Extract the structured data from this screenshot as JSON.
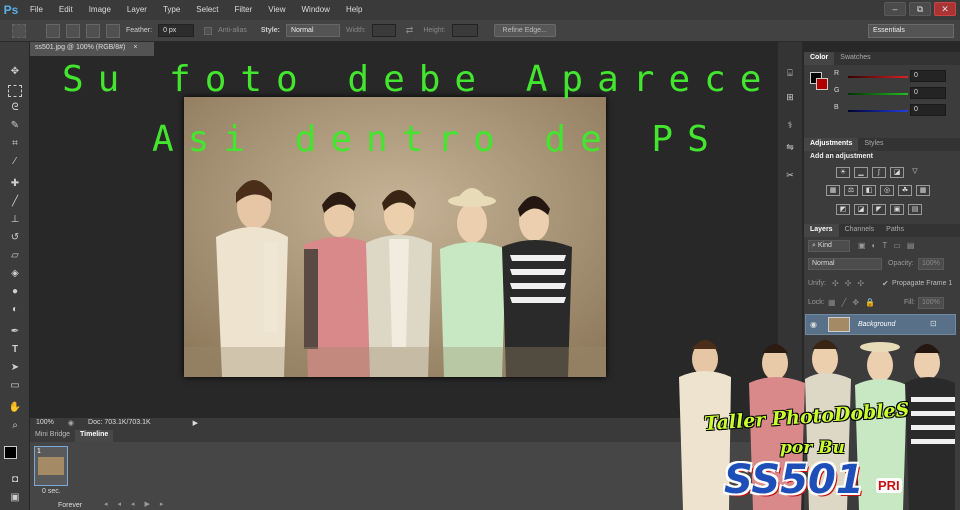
{
  "app": {
    "logo": "Ps"
  },
  "menu": [
    "File",
    "Edit",
    "Image",
    "Layer",
    "Type",
    "Select",
    "Filter",
    "View",
    "Window",
    "Help"
  ],
  "window_controls": [
    "–",
    "⧉",
    "✕"
  ],
  "options_bar": {
    "feather_label": "Feather:",
    "feather_value": "0 px",
    "antialias_label": "Anti-alias",
    "style_label": "Style:",
    "style_value": "Normal",
    "width_label": "Width:",
    "height_label": "Height:",
    "refine_edge": "Refine Edge...",
    "workspace": "Essentials"
  },
  "document": {
    "tab_title": "ss501.jpg @ 100% (RGB/8#)",
    "close": "×",
    "caption_line1": "Su foto  debe Aparecer",
    "caption_line2": "Asi dentro de PS"
  },
  "status_bar": {
    "zoom": "100%",
    "doc": "Doc: 703.1K/703.1K"
  },
  "bottom_tabs": [
    "Mini Bridge",
    "Timeline"
  ],
  "timeline": {
    "frame_number": "1",
    "frame_delay": "0 sec.",
    "loop": "Forever"
  },
  "color_panel": {
    "tabs": [
      "Color",
      "Swatches"
    ],
    "channels": [
      {
        "label": "R",
        "value": "0",
        "color": "#e02020"
      },
      {
        "label": "G",
        "value": "0",
        "color": "#20c020"
      },
      {
        "label": "B",
        "value": "0",
        "color": "#2040e0"
      }
    ]
  },
  "adjustments_panel": {
    "tabs": [
      "Adjustments",
      "Styles"
    ],
    "heading": "Add an adjustment"
  },
  "layers_panel": {
    "tabs": [
      "Layers",
      "Channels",
      "Paths"
    ],
    "kind": "Kind",
    "blend_mode": "Normal",
    "opacity_label": "Opacity:",
    "opacity_value": "100%",
    "unify_label": "Unify:",
    "propagate_label": "Propagate Frame 1",
    "lock_label": "Lock:",
    "fill_label": "Fill:",
    "fill_value": "100%",
    "layer_name": "Background"
  },
  "watermark": {
    "line1": "Taller PhotoDobleS",
    "line2": "por Bu",
    "logo": "SS501",
    "badge": "PRI"
  },
  "colors": {
    "caption": "#43e52e",
    "accent": "#5aaee8",
    "foreground": "#000000",
    "background": "#b00000"
  }
}
